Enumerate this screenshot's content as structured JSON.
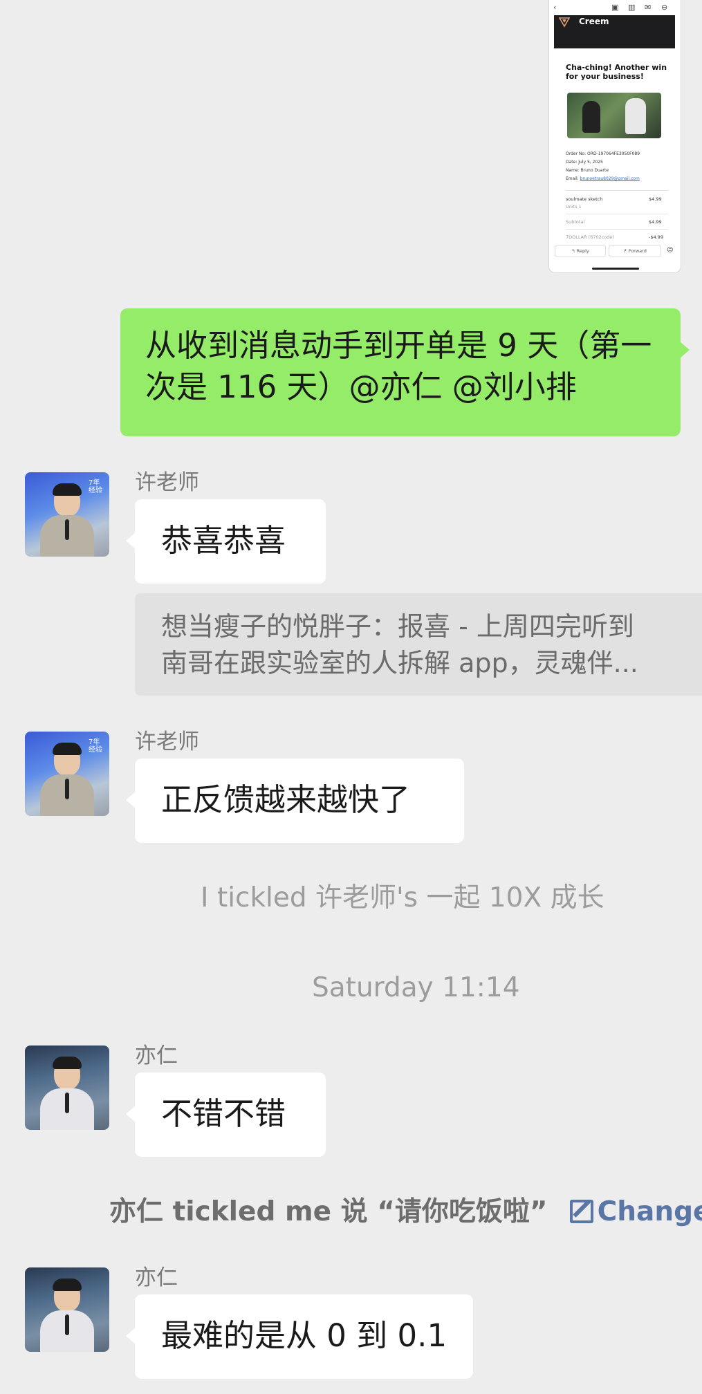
{
  "email_preview": {
    "back_icon": "chevron-left-icon",
    "brand": "Creem",
    "headline": "Cha-ching! Another win for your business!",
    "order_no": "Order No: ORD-197064FE3050F089",
    "date": "Date: July 5, 2025",
    "name": "Name: Bruno Duarte",
    "email_label": "Email:",
    "email": "brunoetrau8029@gmail.com",
    "item_name": "soulmate sketch",
    "item_units": "Units 1",
    "item_price": "$4.99",
    "subtotal_label": "Subtotal",
    "subtotal": "$4.99",
    "discount_label": "7DOLLAR (6702code)",
    "discount": "-$4.99",
    "reply": "Reply",
    "forward": "Forward"
  },
  "messages": [
    {
      "from": "me",
      "text": "从收到消息动手到开单是 9 天（第一次是 116 天）@亦仁 @刘小排"
    },
    {
      "from": "许老师",
      "text": "恭喜恭喜"
    },
    {
      "quote_line1": "想当瘦子的悦胖子：报喜 - 上周四完听到",
      "quote_line2": "南哥在跟实验室的人拆解 app，灵魂伴..."
    },
    {
      "from": "许老师",
      "text": "正反馈越来越快了"
    },
    {
      "system": "I  tickled 许老师's 一起 10X 成长"
    },
    {
      "timestamp": "Saturday 11:14"
    },
    {
      "from": "亦仁",
      "text": "不错不错"
    },
    {
      "system": "亦仁 tickled me  说 “请你吃饭啦”",
      "action": "Change"
    },
    {
      "from": "亦仁",
      "text": "最难的是从 0 到 0.1"
    }
  ],
  "avatar_tag": "7年经验"
}
